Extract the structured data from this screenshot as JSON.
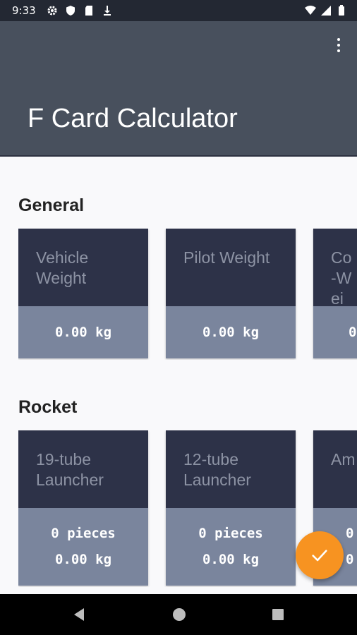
{
  "status_bar": {
    "time": "9:33"
  },
  "app_bar": {
    "title": "F Card Calculator"
  },
  "sections": [
    {
      "title": "General",
      "cards": [
        {
          "label": "Vehicle Weight",
          "values": [
            "0.00 kg"
          ]
        },
        {
          "label": "Pilot Weight",
          "values": [
            "0.00 kg"
          ]
        },
        {
          "label": "Co-Wei",
          "values": [
            "0"
          ]
        }
      ]
    },
    {
      "title": "Rocket",
      "cards": [
        {
          "label": "19-tube Launcher",
          "values": [
            "0 pieces",
            "0.00 kg"
          ]
        },
        {
          "label": "12-tube Launcher",
          "values": [
            "0 pieces",
            "0.00 kg"
          ]
        },
        {
          "label": "Am",
          "values": [
            "0",
            "0"
          ]
        }
      ]
    }
  ],
  "colors": {
    "accent": "#f79321",
    "app_bar": "#48505d",
    "card_top": "#2d3248",
    "card_bottom": "#7a859d"
  }
}
